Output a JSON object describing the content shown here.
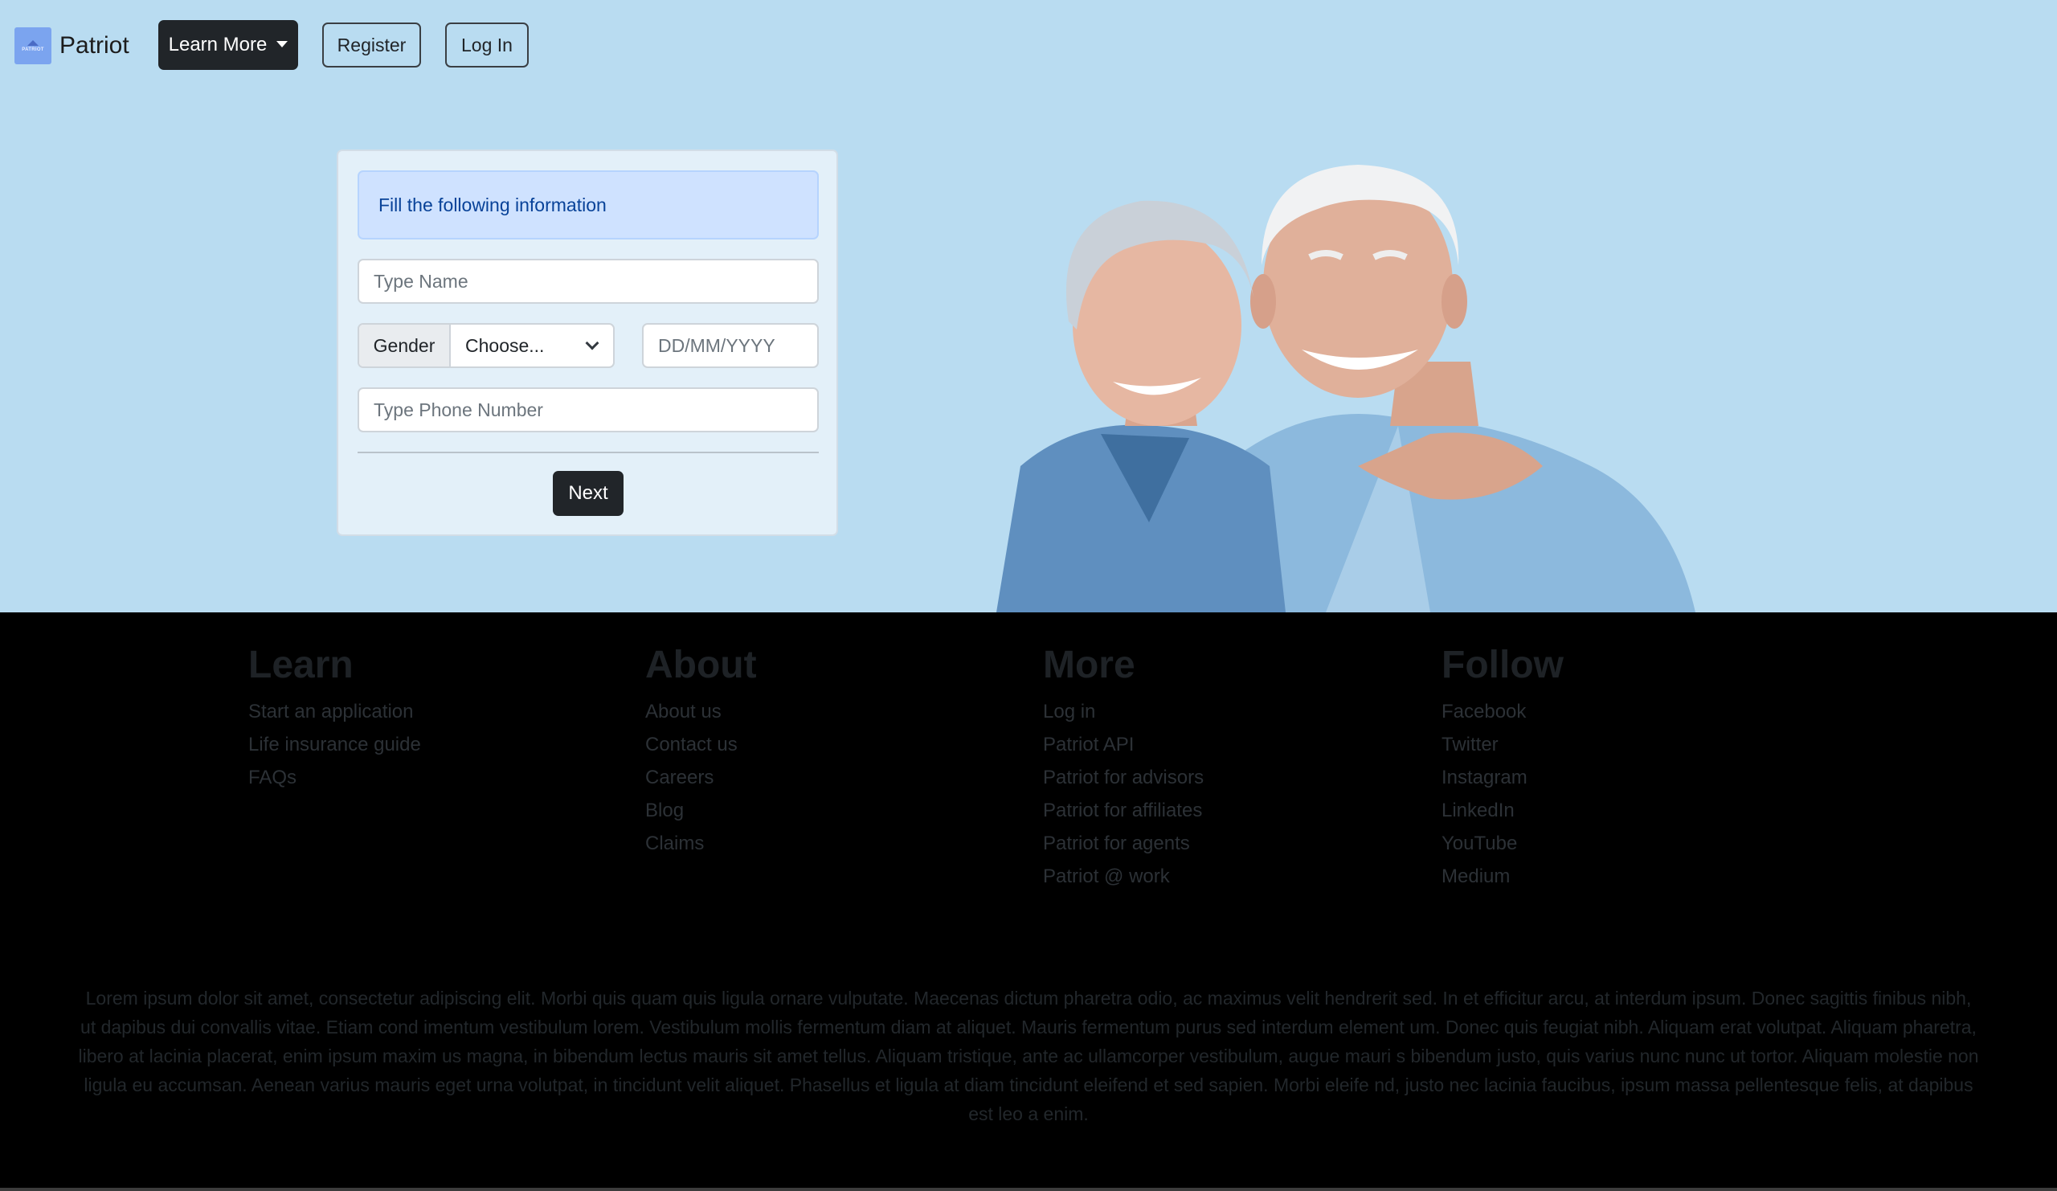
{
  "nav": {
    "brand": "Patriot",
    "logo_text": "PATRIOT",
    "learn_more": "Learn More",
    "register": "Register",
    "login": "Log In"
  },
  "form": {
    "alert": "Fill the following information",
    "name_placeholder": "Type Name",
    "gender_label": "Gender",
    "gender_selected": "Choose...",
    "dob_placeholder": "DD/MM/YYYY",
    "phone_placeholder": "Type Phone Number",
    "next": "Next"
  },
  "footer": {
    "columns": [
      {
        "title": "Learn",
        "links": [
          "Start an application",
          "Life insurance guide",
          "FAQs"
        ]
      },
      {
        "title": "About",
        "links": [
          "About us",
          "Contact us",
          "Careers",
          "Blog",
          "Claims"
        ]
      },
      {
        "title": "More",
        "links": [
          "Log in",
          "Patriot API",
          "Patriot for advisors",
          "Patriot for affiliates",
          "Patriot for agents",
          "Patriot @ work"
        ]
      },
      {
        "title": "Follow",
        "links": [
          "Facebook",
          "Twitter",
          "Instagram",
          "LinkedIn",
          "YouTube",
          "Medium"
        ]
      }
    ],
    "lorem": "Lorem ipsum dolor sit amet, consectetur adipiscing elit. Morbi quis quam quis ligula ornare vulputate. Maecenas dictum pharetra odio, ac maximus velit hendrerit sed. In et efficitur arcu, at interdum ipsum. Donec sagittis finibus nibh, ut dapibus dui convallis vitae. Etiam cond imentum vestibulum lorem. Vestibulum mollis fermentum diam at aliquet. Mauris fermentum purus sed interdum element um. Donec quis feugiat nibh. Aliquam erat volutpat. Aliquam pharetra, libero at lacinia placerat, enim ipsum maxim us magna, in bibendum lectus mauris sit amet tellus. Aliquam tristique, ante ac ullamcorper vestibulum, augue mauri s bibendum justo, quis varius nunc nunc ut tortor. Aliquam molestie non ligula eu accumsan. Aenean varius mauris eget urna volutpat, in tincidunt velit aliquet. Phasellus et ligula at diam tincidunt eleifend et sed sapien. Morbi eleife nd, justo nec lacinia faucibus, ipsum massa pellentesque felis, at dapibus est leo a enim."
  },
  "colors": {
    "hero_bg": "#b9dcf1",
    "dark_button": "#212529",
    "alert_bg": "#cfe2ff",
    "alert_text": "#084298",
    "footer_bg": "#000000"
  }
}
